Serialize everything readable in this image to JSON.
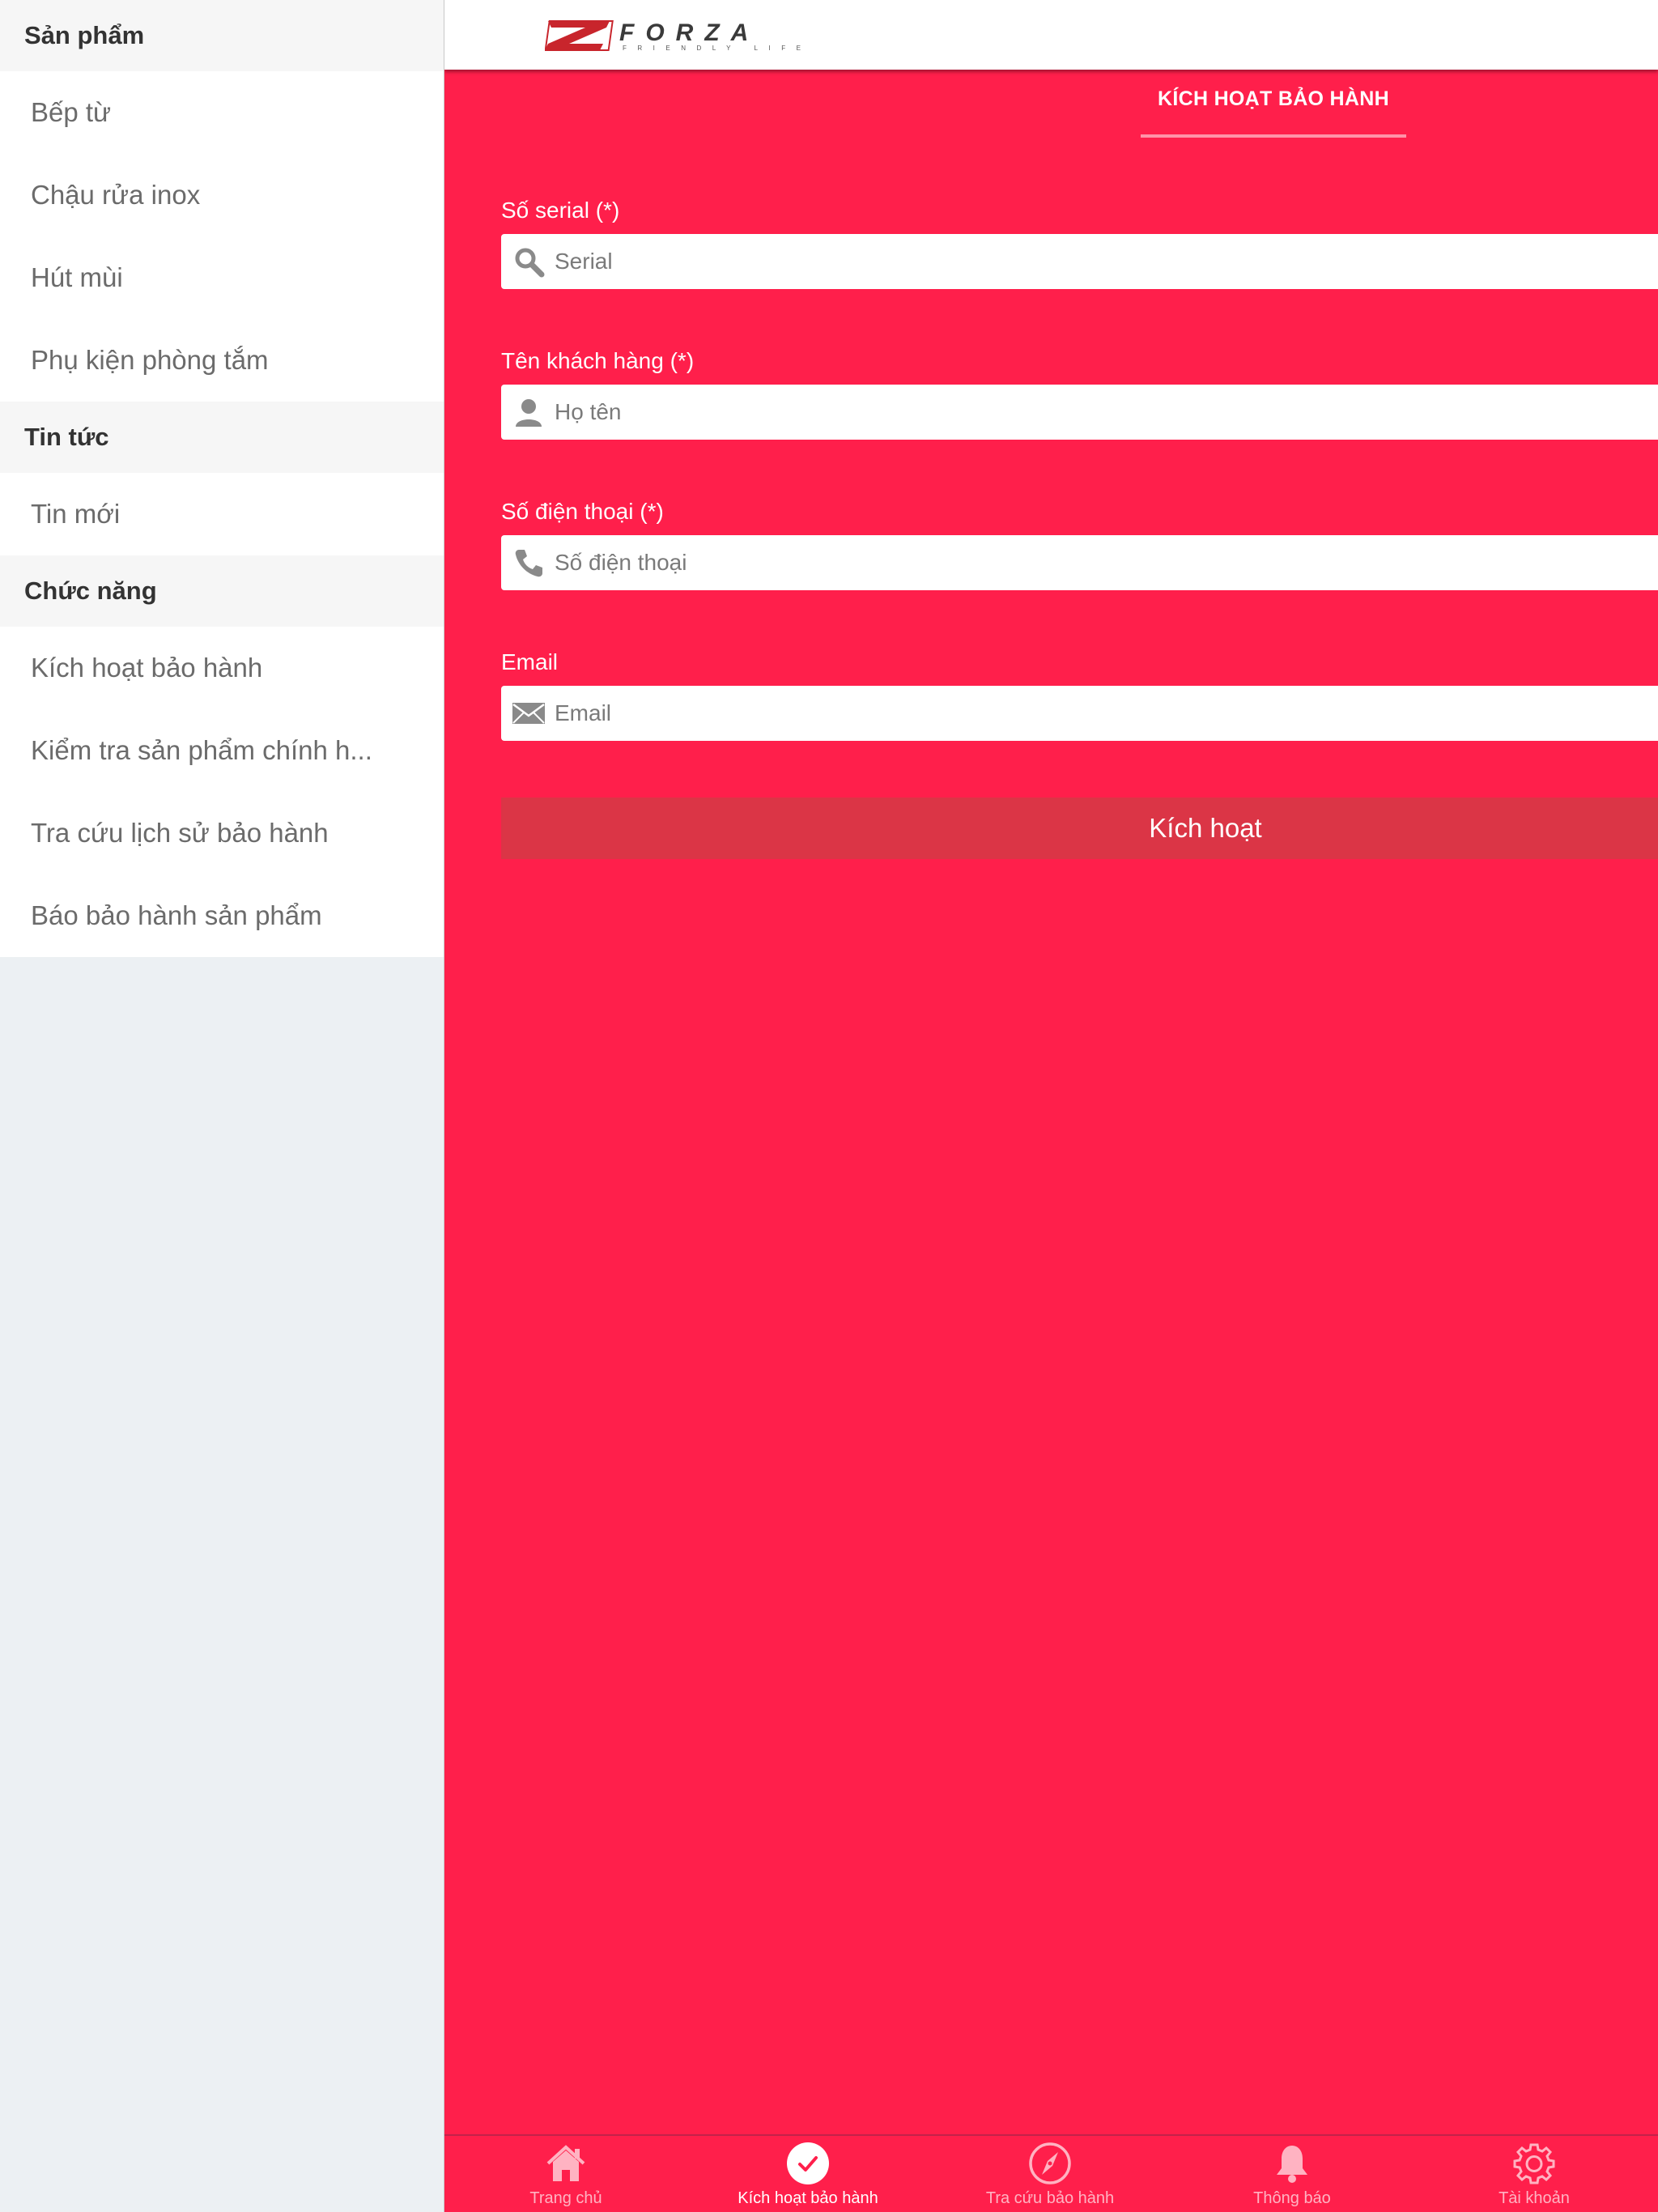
{
  "sidebar": {
    "sections": [
      {
        "title": "Sản phẩm",
        "items": [
          "Bếp từ",
          "Chậu rửa inox",
          "Hút mùi",
          "Phụ kiện phòng tắm"
        ]
      },
      {
        "title": "Tin tức",
        "items": [
          "Tin mới"
        ]
      },
      {
        "title": "Chức năng",
        "items": [
          "Kích hoạt bảo hành",
          "Kiểm tra sản phẩm chính h...",
          "Tra cứu lịch sử bảo hành",
          "Báo bảo hành sản phẩm"
        ]
      }
    ]
  },
  "header": {
    "logo_text": "FORZA",
    "logo_tagline": "FRIENDLY LIFE"
  },
  "tab": {
    "title": "KÍCH HOẠT BẢO HÀNH"
  },
  "form": {
    "serial": {
      "label": "Số serial (*)",
      "placeholder": "Serial",
      "value": ""
    },
    "name": {
      "label": "Tên khách hàng (*)",
      "placeholder": "Họ tên",
      "value": ""
    },
    "phone": {
      "label": "Số điện thoại (*)",
      "placeholder": "Số điện thoại",
      "value": ""
    },
    "email": {
      "label": "Email",
      "placeholder": "Email",
      "value": ""
    },
    "submit_label": "Kích hoạt"
  },
  "bottom_nav": [
    {
      "label": "Trang chủ",
      "icon": "home-icon",
      "active": false
    },
    {
      "label": "Kích hoạt bảo hành",
      "icon": "check-circle-icon",
      "active": true
    },
    {
      "label": "Tra cứu bảo hành",
      "icon": "compass-icon",
      "active": false
    },
    {
      "label": "Thông báo",
      "icon": "bell-icon",
      "active": false
    },
    {
      "label": "Tài khoản",
      "icon": "gear-icon",
      "active": false
    }
  ],
  "colors": {
    "primary": "#ff1f4b",
    "button": "#db3546",
    "sidebar_bg": "#ecf0f3",
    "logo_red": "#c8252c",
    "logo_dark": "#3a3a3a"
  }
}
